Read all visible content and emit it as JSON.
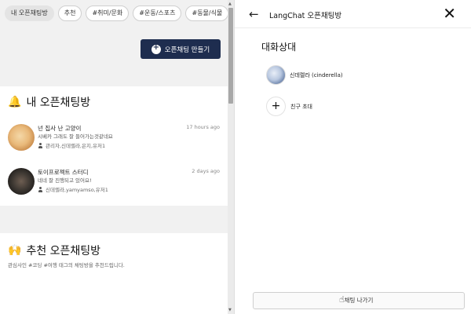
{
  "chips": [
    "내 오픈채팅방",
    "추천",
    "#취미/문화",
    "#운동/스포츠",
    "#동물/식물"
  ],
  "create_button": {
    "label": "오픈채팅 만들기",
    "icon": "chat-bubble-plus-icon"
  },
  "my_rooms": {
    "title": "내 오픈채팅방",
    "emoji": "🔔",
    "rooms": [
      {
        "name": "넌 집사 난 고양이",
        "message": "시베카 그래도 잘 들어가는것같네요",
        "members": "관리자,신데렐라,은지,유저1",
        "time": "17 hours ago"
      },
      {
        "name": "토이프로젝트 스터디",
        "message": "네네 잘 진행되고 있어요!",
        "members": "신데렐라,yamyamso,유저1",
        "time": "2 days ago"
      }
    ]
  },
  "recommend": {
    "title": "추천 오픈채팅방",
    "emoji": "🙌",
    "subtitle": "관심사인 #코딩 #여행 태그의 채팅방을 추천드립니다."
  },
  "panel": {
    "title": "LangChat 오픈채팅방",
    "back_icon": "←",
    "close_icon": "✕",
    "participants_title": "대화상대",
    "participant_name": "신데렐라 (cinderella)",
    "invite_label": "친구 초대",
    "invite_icon": "+",
    "leave_label": "채팅 나가기"
  }
}
